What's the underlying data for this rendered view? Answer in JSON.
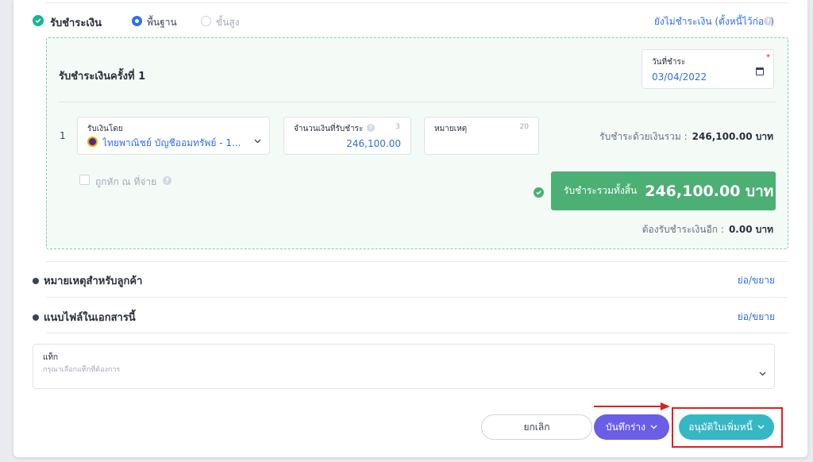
{
  "header": {
    "receive_payment": "รับชำระเงิน",
    "mode_basic": "พื้นฐาน",
    "mode_advanced": "ขั้นสูง",
    "unpaid_link": "ยังไม่ชำระเงิน (ตั้งหนี้ไว้ก่อน)"
  },
  "payment": {
    "title": "รับชำระเงินครั้งที่ 1",
    "date_label": "วันที่ชำระ",
    "date_value": "03/04/2022",
    "row_number": "1",
    "method_label": "รับเงินโดย",
    "method_value": "ไทยพาณิชย์ บัญชีออมทรัพย์ - 1...",
    "amount_label": "จำนวนเงินที่รับชำระ",
    "amount_count": "3",
    "amount_value": "246,100.00",
    "note_label": "หมายเหตุ",
    "note_count": "20",
    "total_by_cash_label": "รับชำระด้วยเงินรวม :",
    "total_by_cash_value": "246,100.00 บาท",
    "withheld_label": "ถูกหัก ณ ที่จ่าย",
    "grand_total_label": "รับชำระรวมทั้งสิ้น",
    "grand_total_value": "246,100.00 บาท",
    "remaining_label": "ต้องรับชำระเงินอีก :",
    "remaining_value": "0.00 บาท"
  },
  "sections": {
    "customer_note": "หมายเหตุสำหรับลูกค้า",
    "attach_files": "แนบไฟล์ในเอกสารนี้",
    "toggle_label": "ย่อ/ขยาย"
  },
  "tags": {
    "label": "แท็ก",
    "placeholder": "กรุณาเลือกแท็กที่ต้องการ"
  },
  "footer": {
    "cancel": "ยกเลิก",
    "save_draft": "บันทึกร่าง",
    "approve": "อนุมัติใบเพิ่มหนี้"
  },
  "colors": {
    "primary": "#2f6fed",
    "success": "#4caf74",
    "draft": "#6b5ee6",
    "approve": "#35b7c4",
    "highlight": "#e02020"
  }
}
